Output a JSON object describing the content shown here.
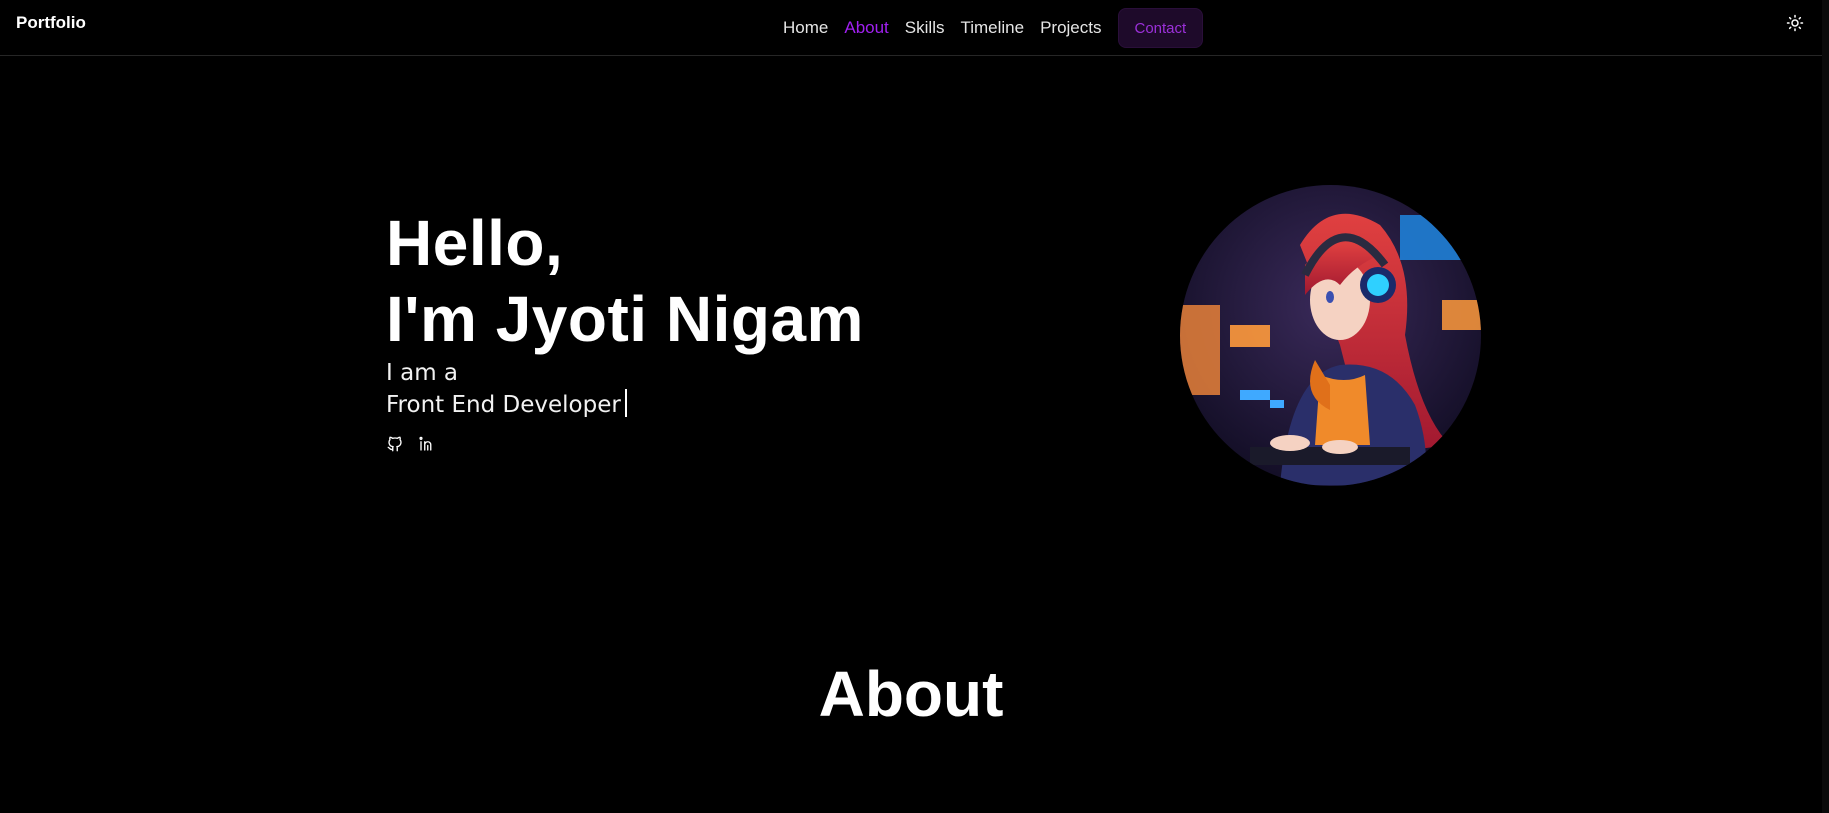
{
  "nav": {
    "brand": "Portfolio",
    "links": [
      {
        "label": "Home",
        "active": false
      },
      {
        "label": "About",
        "active": true
      },
      {
        "label": "Skills",
        "active": false
      },
      {
        "label": "Timeline",
        "active": false
      },
      {
        "label": "Projects",
        "active": false
      }
    ],
    "contact_label": "Contact",
    "theme_toggle_icon": "sun-icon"
  },
  "hero": {
    "greeting": "Hello,",
    "name": "I'm Jyoti Nigam",
    "intro": "I am a",
    "role": "Front End Developer",
    "socials": [
      {
        "icon": "github-icon"
      },
      {
        "icon": "linkedin-icon"
      }
    ],
    "avatar_description_icon": "avatar-illustration"
  },
  "sections": {
    "about_title": "About"
  },
  "colors": {
    "background": "#000000",
    "accent": "#a020f0",
    "contact_bg": "#1e0a2a"
  }
}
